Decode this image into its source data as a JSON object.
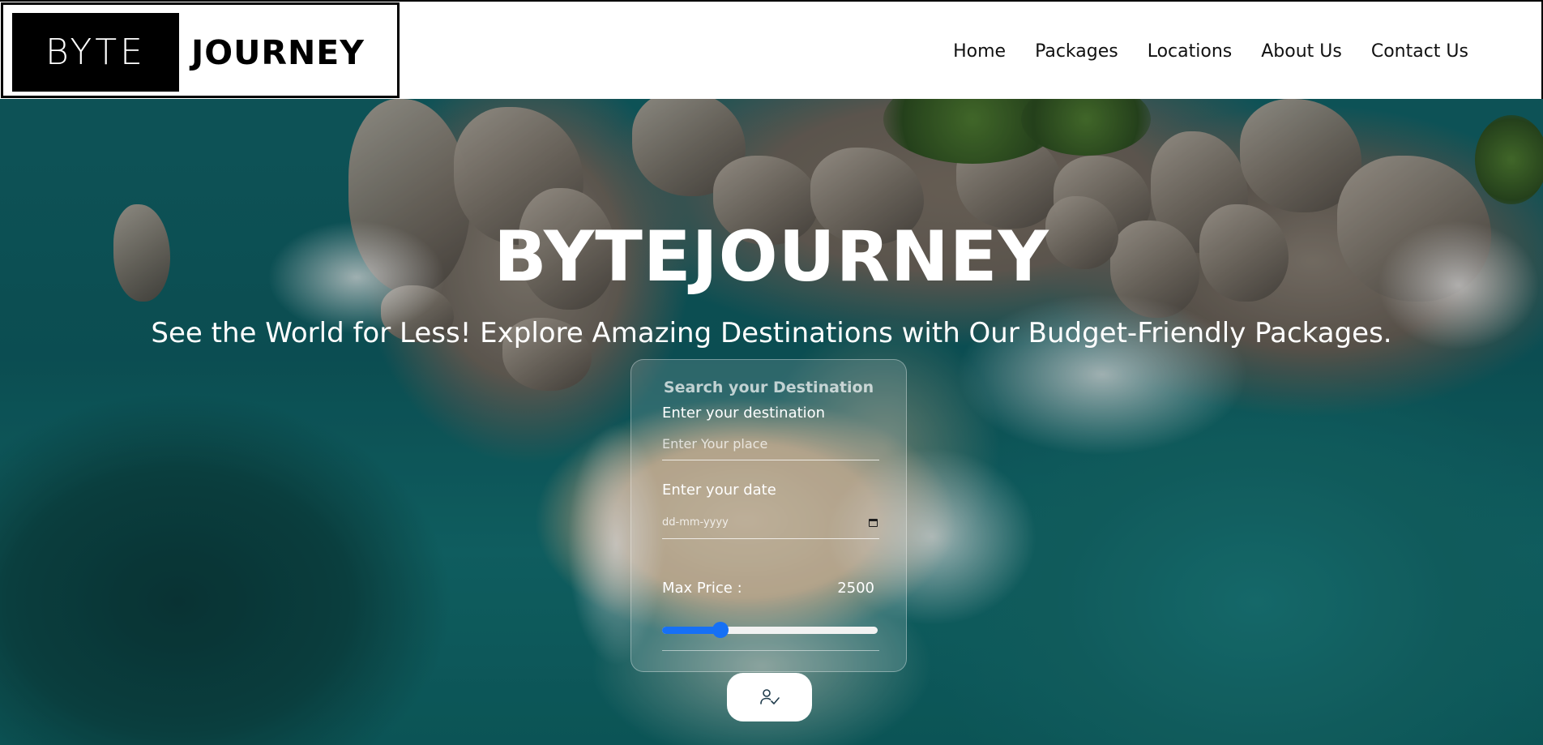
{
  "brand": {
    "logo_left": "BYTE",
    "logo_right": "JOURNEY"
  },
  "nav": {
    "items": [
      {
        "label": "Home"
      },
      {
        "label": "Packages"
      },
      {
        "label": "Locations"
      },
      {
        "label": "About Us"
      },
      {
        "label": "Contact Us"
      }
    ]
  },
  "hero": {
    "title": "BYTEJOURNEY",
    "subtitle": "See the World for Less! Explore Amazing Destinations with Our Budget-Friendly Packages."
  },
  "search_form": {
    "heading": "Search your Destination",
    "destination": {
      "label": "Enter your destination",
      "placeholder": "Enter Your place",
      "value": ""
    },
    "date": {
      "label": "Enter your date",
      "placeholder": "dd-mm-yyyy",
      "icon": "calendar-icon"
    },
    "price": {
      "label": "Max Price :",
      "value": "2500",
      "slider_fraction": 0.27
    },
    "submit": {
      "icon": "user-check-icon"
    }
  },
  "colors": {
    "accent": "#1670f5",
    "header_bg": "#ffffff",
    "logo_block": "#000000"
  }
}
